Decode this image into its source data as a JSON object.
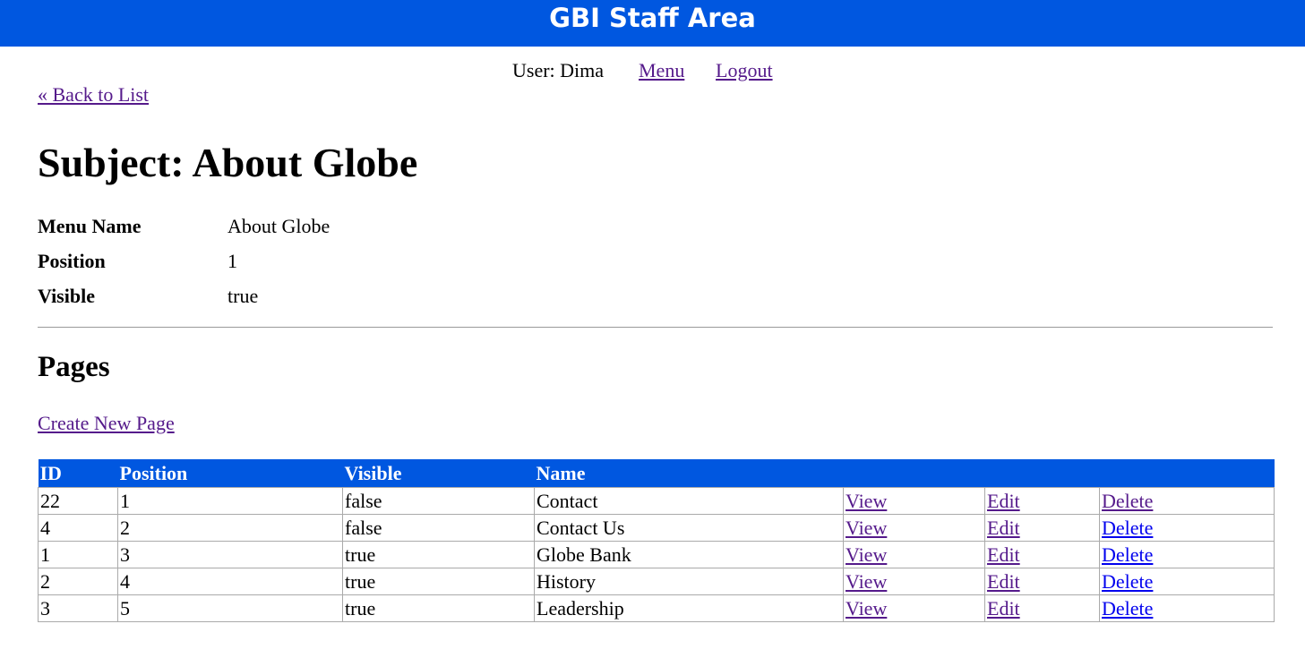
{
  "header": {
    "title": "GBI Staff Area"
  },
  "navigation": {
    "user_text": "User: Dima",
    "menu_label": "Menu",
    "logout_label": "Logout"
  },
  "back_link": "« Back to List",
  "subject": {
    "title": "Subject: About Globe",
    "attributes": [
      {
        "label": "Menu Name",
        "value": "About Globe"
      },
      {
        "label": "Position",
        "value": "1"
      },
      {
        "label": "Visible",
        "value": "true"
      }
    ]
  },
  "pages": {
    "heading": "Pages",
    "create_link": "Create New Page",
    "columns": [
      "ID",
      "Position",
      "Visible",
      "Name"
    ],
    "action_labels": {
      "view": "View",
      "edit": "Edit",
      "delete": "Delete"
    },
    "rows": [
      {
        "id": "22",
        "position": "1",
        "visible": "false",
        "name": "Contact"
      },
      {
        "id": "4",
        "position": "2",
        "visible": "false",
        "name": "Contact Us"
      },
      {
        "id": "1",
        "position": "3",
        "visible": "true",
        "name": "Globe Bank"
      },
      {
        "id": "2",
        "position": "4",
        "visible": "true",
        "name": "History"
      },
      {
        "id": "3",
        "position": "5",
        "visible": "true",
        "name": "Leadership"
      }
    ]
  },
  "colors": {
    "header_bg": "#0057e0",
    "visited_link": "#551a8b",
    "unvisited_link": "#0000ee"
  }
}
